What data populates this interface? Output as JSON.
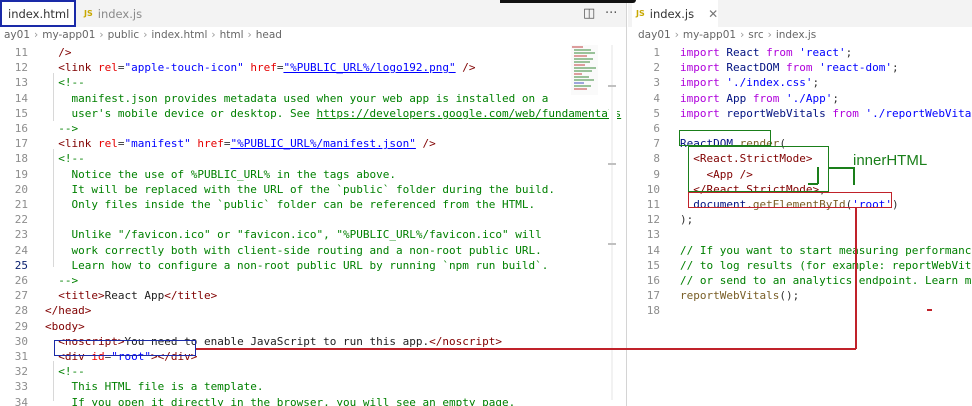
{
  "left_editor": {
    "active_tab": "index.html",
    "inactive_tab": "index.js",
    "breadcrumb": [
      "ay01",
      "my-app01",
      "public",
      "index.html",
      "html",
      "head"
    ],
    "lines": [
      {
        "n": "11",
        "t": [
          [
            "  />",
            "tag"
          ]
        ]
      },
      {
        "n": "12",
        "t": [
          [
            "  <link ",
            "tag"
          ],
          [
            "rel",
            "attr"
          ],
          [
            "=",
            "punc"
          ],
          [
            "\"apple-touch-icon\"",
            "str"
          ],
          [
            " ",
            "plain"
          ],
          [
            "href",
            "attr"
          ],
          [
            "=",
            "punc"
          ],
          [
            "\"%PUBLIC_URL%/logo192.png\"",
            "str link"
          ],
          [
            " />",
            "tag"
          ]
        ]
      },
      {
        "n": "13",
        "t": [
          [
            "  <!--",
            "cmt"
          ]
        ]
      },
      {
        "n": "14",
        "t": [
          [
            "    manifest.json provides metadata used when your web app is installed on a",
            "cmt"
          ]
        ]
      },
      {
        "n": "15",
        "t": [
          [
            "    user's mobile device or desktop. See ",
            "cmt"
          ],
          [
            "https://developers.google.com/web/fundamentals",
            "cmt link"
          ]
        ]
      },
      {
        "n": "16",
        "t": [
          [
            "  -->",
            "cmt"
          ]
        ]
      },
      {
        "n": "17",
        "t": [
          [
            "  <link ",
            "tag"
          ],
          [
            "rel",
            "attr"
          ],
          [
            "=",
            "punc"
          ],
          [
            "\"manifest\"",
            "str"
          ],
          [
            " ",
            "plain"
          ],
          [
            "href",
            "attr"
          ],
          [
            "=",
            "punc"
          ],
          [
            "\"%PUBLIC_URL%/manifest.json\"",
            "str link"
          ],
          [
            " />",
            "tag"
          ]
        ]
      },
      {
        "n": "18",
        "t": [
          [
            "  <!--",
            "cmt"
          ]
        ]
      },
      {
        "n": "19",
        "t": [
          [
            "    Notice the use of %PUBLIC_URL% in the tags above.",
            "cmt"
          ]
        ]
      },
      {
        "n": "20",
        "t": [
          [
            "    It will be replaced with the URL of the `public` folder during the build.",
            "cmt"
          ]
        ]
      },
      {
        "n": "21",
        "t": [
          [
            "    Only files inside the `public` folder can be referenced from the HTML.",
            "cmt"
          ]
        ]
      },
      {
        "n": "22",
        "t": [
          [
            "",
            "cmt"
          ]
        ]
      },
      {
        "n": "23",
        "t": [
          [
            "    Unlike \"/favicon.ico\" or \"favicon.ico\", \"%PUBLIC_URL%/favicon.ico\" will",
            "cmt"
          ]
        ]
      },
      {
        "n": "24",
        "t": [
          [
            "    work correctly both with client-side routing and a non-root public URL.",
            "cmt"
          ]
        ]
      },
      {
        "n": "25",
        "t": [
          [
            "    Learn how to configure a non-root public URL by running `npm run build`.",
            "cmt"
          ]
        ],
        "active": true
      },
      {
        "n": "26",
        "t": [
          [
            "  -->",
            "cmt"
          ]
        ]
      },
      {
        "n": "27",
        "t": [
          [
            "  <title>",
            "tag"
          ],
          [
            "React App",
            "plain"
          ],
          [
            "</title>",
            "tag"
          ]
        ]
      },
      {
        "n": "28",
        "t": [
          [
            "</head>",
            "tag"
          ]
        ]
      },
      {
        "n": "29",
        "t": [
          [
            "<body>",
            "tag"
          ]
        ]
      },
      {
        "n": "30",
        "t": [
          [
            "  <noscript>",
            "tag"
          ],
          [
            "You need to enable JavaScript to run this app.",
            "plain"
          ],
          [
            "</noscript>",
            "tag"
          ]
        ]
      },
      {
        "n": "31",
        "t": [
          [
            "  <div ",
            "tag"
          ],
          [
            "id",
            "attr"
          ],
          [
            "=",
            "punc"
          ],
          [
            "\"root\"",
            "str"
          ],
          [
            "></div>",
            "tag"
          ]
        ]
      },
      {
        "n": "32",
        "t": [
          [
            "  <!--",
            "cmt"
          ]
        ]
      },
      {
        "n": "33",
        "t": [
          [
            "    This HTML file is a template.",
            "cmt"
          ]
        ]
      },
      {
        "n": "34",
        "t": [
          [
            "    If you open it directly in the browser, you will see an empty page.",
            "cmt"
          ]
        ]
      }
    ]
  },
  "right_editor": {
    "active_tab": "index.js",
    "breadcrumb": [
      "day01",
      "my-app01",
      "src",
      "index.js"
    ],
    "lines": [
      {
        "n": "1",
        "t": [
          [
            "import",
            "kw"
          ],
          [
            " React ",
            "var"
          ],
          [
            "from",
            "kw"
          ],
          [
            " 'react'",
            "str"
          ],
          [
            ";",
            "punc"
          ]
        ]
      },
      {
        "n": "2",
        "t": [
          [
            "import",
            "kw"
          ],
          [
            " ReactDOM ",
            "var"
          ],
          [
            "from",
            "kw"
          ],
          [
            " 'react-dom'",
            "str"
          ],
          [
            ";",
            "punc"
          ]
        ]
      },
      {
        "n": "3",
        "t": [
          [
            "import",
            "kw"
          ],
          [
            " './index.css'",
            "str"
          ],
          [
            ";",
            "punc"
          ]
        ]
      },
      {
        "n": "4",
        "t": [
          [
            "import",
            "kw"
          ],
          [
            " App ",
            "var"
          ],
          [
            "from",
            "kw"
          ],
          [
            " './App'",
            "str"
          ],
          [
            ";",
            "punc"
          ]
        ]
      },
      {
        "n": "5",
        "t": [
          [
            "import",
            "kw"
          ],
          [
            " reportWebVitals ",
            "var"
          ],
          [
            "from",
            "kw"
          ],
          [
            " './reportWebVitals'",
            "str"
          ],
          [
            ";",
            "punc"
          ]
        ]
      },
      {
        "n": "6",
        "t": [
          [
            "",
            "plain"
          ]
        ]
      },
      {
        "n": "7",
        "t": [
          [
            "ReactDOM",
            "var"
          ],
          [
            ".",
            "punc"
          ],
          [
            "render",
            "fn"
          ],
          [
            "(",
            "punc"
          ]
        ]
      },
      {
        "n": "8",
        "t": [
          [
            "  <React.StrictMode>",
            "tag"
          ]
        ]
      },
      {
        "n": "9",
        "t": [
          [
            "    <App />",
            "tag"
          ]
        ]
      },
      {
        "n": "10",
        "t": [
          [
            "  </React.StrictMode>",
            "tag"
          ],
          [
            ",",
            "punc"
          ]
        ]
      },
      {
        "n": "11",
        "t": [
          [
            "  document",
            "var"
          ],
          [
            ".",
            "punc"
          ],
          [
            "getElementById",
            "fn"
          ],
          [
            "(",
            "punc"
          ],
          [
            "'root'",
            "str"
          ],
          [
            ")",
            "punc"
          ]
        ]
      },
      {
        "n": "12",
        "t": [
          [
            ");",
            "punc"
          ]
        ]
      },
      {
        "n": "13",
        "t": [
          [
            "",
            "plain"
          ]
        ]
      },
      {
        "n": "14",
        "t": [
          [
            "// If you want to start measuring performance in",
            "cmt"
          ]
        ]
      },
      {
        "n": "15",
        "t": [
          [
            "// to log results (for example: reportWebVitals(c",
            "cmt"
          ]
        ]
      },
      {
        "n": "16",
        "t": [
          [
            "// or send to an analytics endpoint. Learn more:",
            "cmt"
          ]
        ]
      },
      {
        "n": "17",
        "t": [
          [
            "reportWebVitals",
            "fn"
          ],
          [
            "();",
            "punc"
          ]
        ]
      },
      {
        "n": "18",
        "t": [
          [
            "",
            "plain"
          ]
        ]
      }
    ]
  },
  "annotation": {
    "label": "innerHTML",
    "color": "#1a7f1a",
    "red": "#c0222a",
    "blue": "#1a2aa8"
  },
  "icons": [
    "split-editor-icon",
    "more-actions-icon",
    "close-icon",
    "chevron-right-icon",
    "html-icon",
    "element-icon",
    "js-file-icon"
  ]
}
